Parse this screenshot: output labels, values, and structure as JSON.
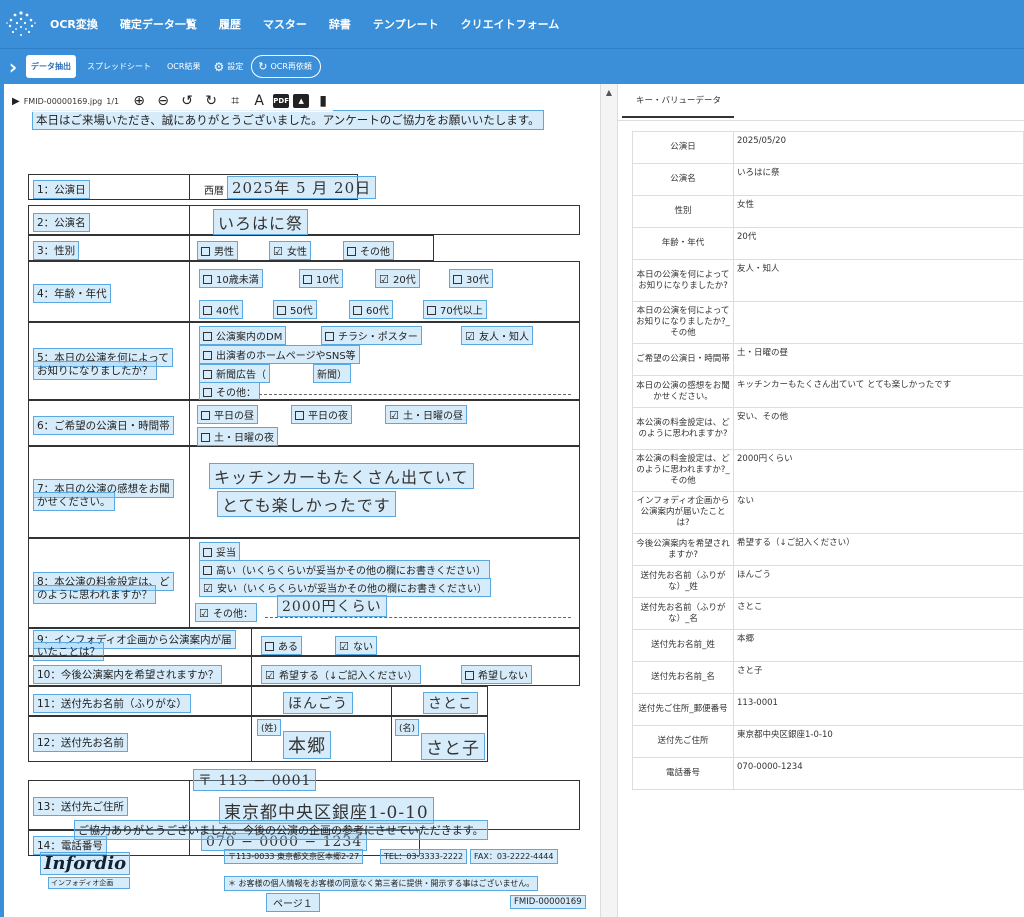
{
  "nav": {
    "items": [
      "OCR変換",
      "確定データ一覧",
      "履歴",
      "マスター",
      "辞書",
      "テンプレート",
      "クリエイトフォーム"
    ]
  },
  "subbar": {
    "tabs": [
      "データ抽出",
      "スプレッドシート",
      "OCR結果"
    ],
    "settings": "設定",
    "reocr": "OCR再依頼"
  },
  "viewer": {
    "filename": "FMID-00000169.jpg",
    "page": "1/1"
  },
  "doc": {
    "headline": "本日はご来場いただき、誠にありがとうございました。アンケートのご協力をお願いいたします。",
    "q1": {
      "label": "1：公演日",
      "era": "西暦",
      "value": "2025年 5 月 20日"
    },
    "q2": {
      "label": "2：公演名",
      "value": "いろはに祭"
    },
    "q3": {
      "label": "3：性別",
      "opt1": "男性",
      "opt2": "女性",
      "opt3": "その他"
    },
    "q4": {
      "label": "4：年齢・年代",
      "opts": [
        "10歳未満",
        "10代",
        "20代",
        "30代",
        "40代",
        "50代",
        "60代",
        "70代以上"
      ]
    },
    "q5": {
      "label1": "5：本日の公演を何によって",
      "label2": "お知りになりましたか？",
      "opt1": "公演案内のDM",
      "opt2": "チラシ・ポスター",
      "opt3": "友人・知人",
      "opt4": "出演者のホームページやSNS等",
      "opt5": "新聞広告（",
      "opt5b": "新聞）",
      "opt6": "その他："
    },
    "q6": {
      "label": "6：ご希望の公演日・時間帯",
      "opt1": "平日の昼",
      "opt2": "平日の夜",
      "opt3": "土・日曜の昼",
      "opt4": "土・日曜の夜"
    },
    "q7": {
      "label1": "7：本日の公演の感想をお聞",
      "label2": "かせください。",
      "line1": "キッチンカーもたくさん出ていて",
      "line2": "とても楽しかったです"
    },
    "q8": {
      "label1": "8：本公演の料金設定は、ど",
      "label2": "のように思われますか？",
      "opt1": "妥当",
      "opt2": "高い（いくらくらいが妥当かその他の欄にお書きください）",
      "opt3": "安い（いくらくらいが妥当かその他の欄にお書きください）",
      "opt4": "その他：",
      "other": "2000円くらい"
    },
    "q9": {
      "label1": "9：インフォディオ企画から公演案内が届",
      "label2": "いたことは？",
      "opt1": "ある",
      "opt2": "ない"
    },
    "q10": {
      "label": "10：今後公演案内を希望されますか？",
      "opt1": "希望する（↓ご記入ください）",
      "opt2": "希望しない"
    },
    "q11": {
      "label": "11：送付先お名前（ふりがな）",
      "sei": "ほんごう",
      "mei": "さとこ"
    },
    "q12": {
      "label": "12：送付先お名前",
      "sei_tag": "(姓)",
      "mei_tag": "(名)",
      "sei": "本郷",
      "mei": "さと子"
    },
    "q13": {
      "label": "13：送付先ご住所",
      "zip": "〒 113 − 0001",
      "address": "東京都中央区銀座1-0-10"
    },
    "q14": {
      "label": "14：電話番号",
      "value": "070 − 0000 − 1234"
    },
    "thanks": "ご協力ありがとうございました。今後の公演の企画の参考にさせていただきます。",
    "brand": "Infordio",
    "brand_sub": "インフォディオ企画",
    "addr1": "〒113-0033 東京都文京区本郷2-27",
    "addr2": "TEL：03-3333-2222",
    "addr3": "FAX：03-2222-4444",
    "privacy": "＊ お客様の個人情報をお客様の同意なく第三者に提供・開示する事はございません。",
    "page": "ページ１",
    "fmid": "FMID-00000169"
  },
  "kv": {
    "tab": "キー・バリューデータ",
    "rows": [
      {
        "k": "公演日",
        "v": "2025/05/20"
      },
      {
        "k": "公演名",
        "v": "いろはに祭"
      },
      {
        "k": "性別",
        "v": "女性"
      },
      {
        "k": "年齢・年代",
        "v": "20代"
      },
      {
        "k": "本日の公演を何によってお知りになりましたか?",
        "v": "友人・知人"
      },
      {
        "k": "本日の公演を何によってお知りになりましたか?_その他",
        "v": ""
      },
      {
        "k": "ご希望の公演日・時間帯",
        "v": "土・日曜の昼"
      },
      {
        "k": "本日の公演の感想をお聞かせください。",
        "v": "キッチンカーもたくさん出ていて とても楽しかったです"
      },
      {
        "k": "本公演の料金設定は、どのように思われますか?",
        "v": "安い、その他"
      },
      {
        "k": "本公演の料金設定は、どのように思われますか?_その他",
        "v": "2000円くらい"
      },
      {
        "k": "インフォディオ企画から公演案内が届いたことは?",
        "v": "ない"
      },
      {
        "k": "今後公演案内を希望されますか?",
        "v": "希望する（↓ご記入ください）"
      },
      {
        "k": "送付先お名前（ふりがな）_姓",
        "v": "ほんごう"
      },
      {
        "k": "送付先お名前（ふりがな）_名",
        "v": "さとこ"
      },
      {
        "k": "送付先お名前_姓",
        "v": "本郷"
      },
      {
        "k": "送付先お名前_名",
        "v": "さと子"
      },
      {
        "k": "送付先ご住所_郵便番号",
        "v": "113-0001"
      },
      {
        "k": "送付先ご住所",
        "v": "東京都中央区銀座1-0-10"
      },
      {
        "k": "電話番号",
        "v": "070-0000-1234"
      }
    ]
  }
}
